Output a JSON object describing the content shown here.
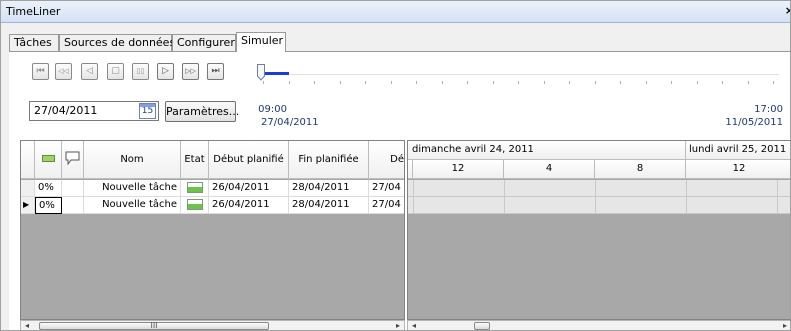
{
  "window": {
    "title": "TimeLiner",
    "close_glyph": "×"
  },
  "tabs": [
    {
      "label": "Tâches"
    },
    {
      "label": "Sources de données"
    },
    {
      "label": "Configurer"
    },
    {
      "label": "Simuler"
    }
  ],
  "playback": {
    "buttons": [
      {
        "name": "go-to-start-icon",
        "glyph": "⏮"
      },
      {
        "name": "step-back-icon",
        "glyph": "◁◁"
      },
      {
        "name": "play-reverse-icon",
        "glyph": "◁"
      },
      {
        "name": "stop-icon",
        "glyph": "▢"
      },
      {
        "name": "pause-icon",
        "glyph": "▯▯"
      },
      {
        "name": "play-icon",
        "glyph": "▷"
      },
      {
        "name": "step-forward-icon",
        "glyph": "▷▷"
      },
      {
        "name": "go-to-end-icon",
        "glyph": "⏭"
      }
    ],
    "slider_position": 0.0
  },
  "date_field": {
    "value": "27/04/2011",
    "calendar_day": "15"
  },
  "params_button": {
    "label": "Paramètres..."
  },
  "time_start": {
    "time": "09:00",
    "date": "27/04/2011"
  },
  "time_end": {
    "time": "17:00",
    "date": "11/05/2011"
  },
  "task_grid": {
    "headers": [
      "",
      "",
      "",
      "Nom",
      "Etat",
      "Début planifié",
      "Fin planifiée",
      "Dé"
    ],
    "rows": [
      {
        "marker": "",
        "active": "0%",
        "name": "Nouvelle tâche",
        "start": "26/04/2011",
        "end": "28/04/2011",
        "actual": "27/04"
      },
      {
        "marker": "▶",
        "active": "0%",
        "name": "Nouvelle tâche",
        "start": "26/04/2011",
        "end": "28/04/2011",
        "actual": "27/04"
      }
    ]
  },
  "gantt": {
    "days": [
      "dimanche avril 24, 2011",
      "lundi avril 25, 2011"
    ],
    "hours": [
      "12",
      "4",
      "8",
      "12"
    ]
  },
  "scrollbars": {
    "left_thumb_glyph": "III",
    "left_arrow": "◂",
    "right_arrow": "▸"
  },
  "colors": {
    "accent": "#1a3fd8",
    "grid_empty": "#a8a8a8",
    "title_bar": "#d4e2f4"
  }
}
